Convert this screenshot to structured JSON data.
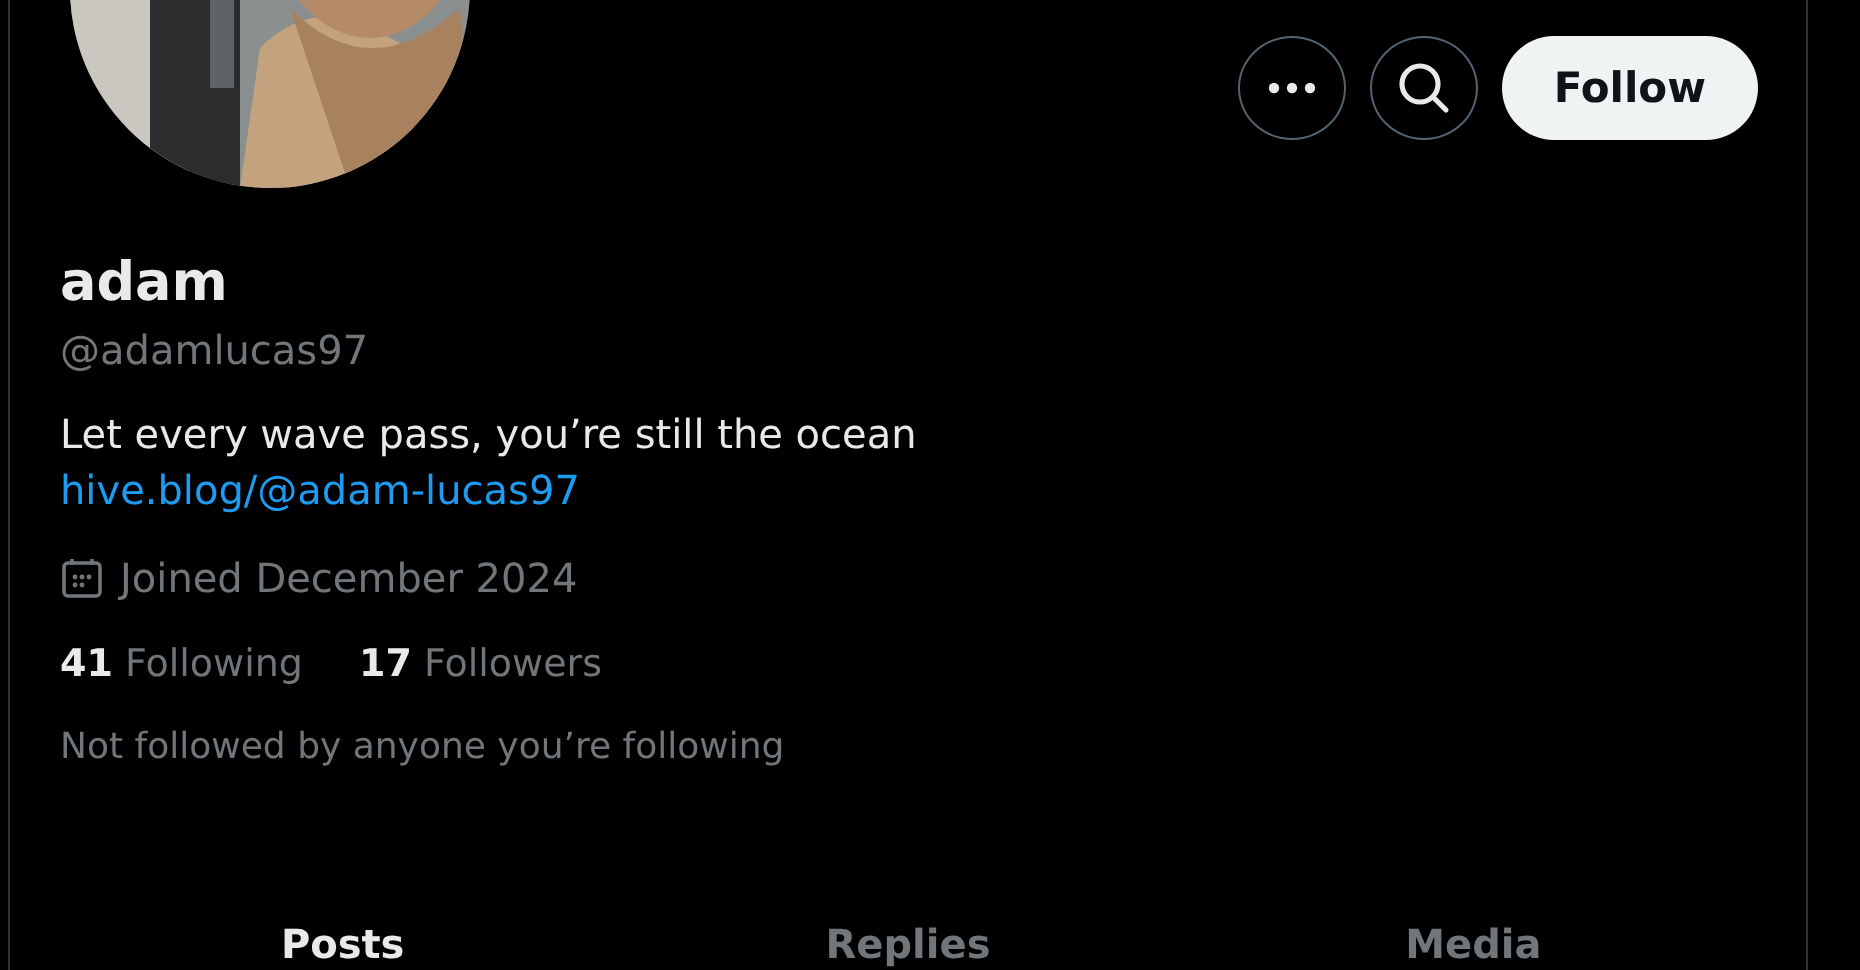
{
  "profile": {
    "name": "adam",
    "handle": "@adamlucas97",
    "bio": "Let every wave pass, you’re still the ocean",
    "link": "hive.blog/@adam-lucas97",
    "joined": "Joined December 2024",
    "stats": [
      {
        "count": "41",
        "label": "Following"
      },
      {
        "count": "17",
        "label": "Followers"
      }
    ],
    "followed_by": "Not followed by anyone you’re following"
  },
  "actions": [
    {
      "kind": "more"
    },
    {
      "kind": "search"
    },
    {
      "kind": "follow",
      "label": "Follow"
    }
  ],
  "tabs": [
    {
      "label": "Posts",
      "selected": true
    },
    {
      "label": "Replies",
      "selected": false
    },
    {
      "label": "Media",
      "selected": false
    }
  ]
}
